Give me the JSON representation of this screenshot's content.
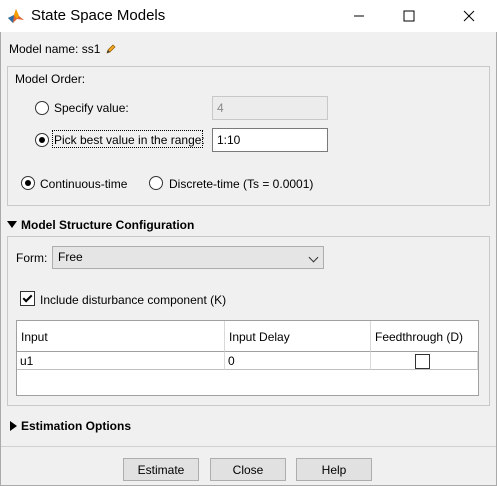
{
  "window": {
    "title": "State Space Models",
    "icons": {
      "app": "matlab-logo-icon",
      "minimize": "minimize-icon",
      "maximize": "maximize-icon",
      "close": "close-icon"
    }
  },
  "model_name": {
    "label": "Model name: ss1",
    "edit_icon": "pencil-icon"
  },
  "model_order": {
    "label": "Model Order:",
    "specify": {
      "label": "Specify value:",
      "value": "4",
      "selected": false
    },
    "pick_best": {
      "label": "Pick best value in the range:",
      "value": "1:10",
      "selected": true
    }
  },
  "time_domain": {
    "continuous": {
      "label": "Continuous-time",
      "selected": true
    },
    "discrete": {
      "label": "Discrete-time (Ts = 0.0001)",
      "selected": false
    }
  },
  "structure": {
    "header": "Model Structure Configuration",
    "form_label": "Form:",
    "form_value": "Free",
    "disturbance": {
      "label": "Include disturbance component (K)",
      "checked": true
    },
    "table": {
      "columns": [
        "Input",
        "Input Delay",
        "Feedthrough (D)"
      ],
      "rows": [
        {
          "input": "u1",
          "delay": "0",
          "feedthrough": false
        }
      ]
    }
  },
  "estimation_options": {
    "header": "Estimation Options"
  },
  "buttons": {
    "estimate": "Estimate",
    "close": "Close",
    "help": "Help"
  }
}
